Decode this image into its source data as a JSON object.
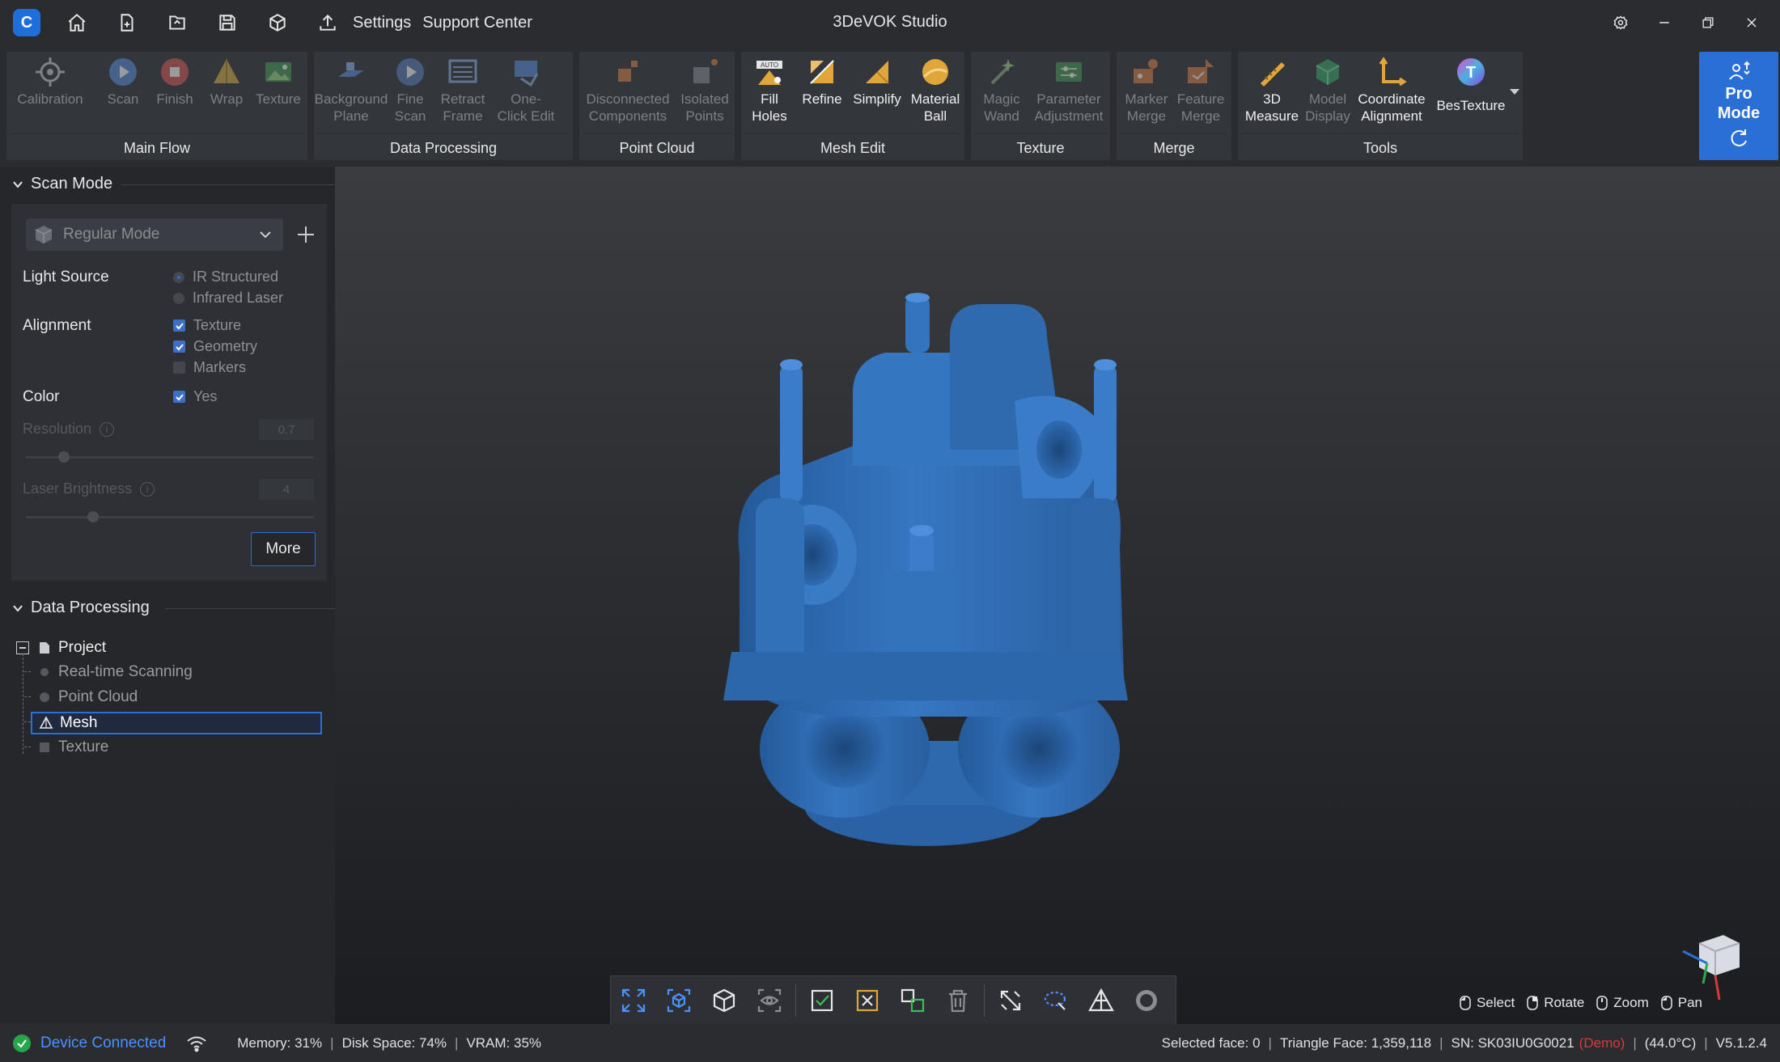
{
  "titlebar": {
    "logo": "C",
    "settings": "Settings",
    "support": "Support Center",
    "title": "3DeVOK Studio"
  },
  "ribbon": {
    "groups": [
      {
        "label": "Main Flow",
        "tools": [
          {
            "label": "Calibration",
            "icon": "crosshair-icon",
            "enabled": false
          },
          {
            "label": "Scan",
            "icon": "play-icon",
            "enabled": false
          },
          {
            "label": "Finish",
            "icon": "stop-icon",
            "enabled": false
          },
          {
            "label": "Wrap",
            "icon": "pyramid-icon",
            "enabled": false
          },
          {
            "label": "Texture",
            "icon": "image-icon",
            "enabled": false
          }
        ]
      },
      {
        "label": "Data Processing",
        "tools": [
          {
            "label": "Background\nPlane",
            "icon": "plane-icon",
            "enabled": false
          },
          {
            "label": "Fine\nScan",
            "icon": "fine-scan-icon",
            "enabled": false
          },
          {
            "label": "Retract\nFrame",
            "icon": "frame-icon",
            "enabled": false
          },
          {
            "label": "One-\nClick Edit",
            "icon": "edit-icon",
            "enabled": false
          }
        ]
      },
      {
        "label": "Point Cloud",
        "tools": [
          {
            "label": "Disconnected\nComponents",
            "icon": "components-icon",
            "enabled": false
          },
          {
            "label": "Isolated\nPoints",
            "icon": "points-icon",
            "enabled": false
          }
        ]
      },
      {
        "label": "Mesh Edit",
        "tools": [
          {
            "label": "Fill\nHoles",
            "icon": "fill-holes-icon",
            "enabled": true
          },
          {
            "label": "Refine",
            "icon": "refine-icon",
            "enabled": true
          },
          {
            "label": "Simplify",
            "icon": "simplify-icon",
            "enabled": true
          },
          {
            "label": "Material\nBall",
            "icon": "material-ball-icon",
            "enabled": true
          }
        ]
      },
      {
        "label": "Texture",
        "tools": [
          {
            "label": "Magic\nWand",
            "icon": "magic-wand-icon",
            "enabled": false
          },
          {
            "label": "Parameter\nAdjustment",
            "icon": "parameter-icon",
            "enabled": false
          }
        ]
      },
      {
        "label": "Merge",
        "tools": [
          {
            "label": "Marker\nMerge",
            "icon": "marker-merge-icon",
            "enabled": false
          },
          {
            "label": "Feature\nMerge",
            "icon": "feature-merge-icon",
            "enabled": false
          }
        ]
      },
      {
        "label": "Tools",
        "tools": [
          {
            "label": "3D\nMeasure",
            "icon": "measure-icon",
            "enabled": true
          },
          {
            "label": "Model\nDisplay",
            "icon": "model-display-icon",
            "enabled": false
          },
          {
            "label": "Coordinate\nAlignment",
            "icon": "coordinate-icon",
            "enabled": true
          },
          {
            "label": "BesTexture",
            "icon": "bestexture-icon",
            "enabled": true
          }
        ]
      }
    ],
    "pro_mode": "Pro\nMode"
  },
  "left_panel": {
    "scan_mode_header": "Scan Mode",
    "mode_select": "Regular Mode",
    "light_source_label": "Light Source",
    "light_options": [
      "IR Structured",
      "Infrared Laser"
    ],
    "alignment_label": "Alignment",
    "alignment_options": [
      "Texture",
      "Geometry",
      "Markers"
    ],
    "color_label": "Color",
    "color_option": "Yes",
    "resolution_label": "Resolution",
    "resolution_value": "0.7",
    "laser_label": "Laser Brightness",
    "laser_value": "4",
    "more_button": "More",
    "data_processing_header": "Data Processing",
    "tree": {
      "root": "Project",
      "items": [
        "Real-time Scanning",
        "Point Cloud",
        "Mesh",
        "Texture"
      ],
      "selected": "Mesh"
    }
  },
  "viewport": {
    "nav_hints": [
      "Select",
      "Rotate",
      "Zoom",
      "Pan"
    ]
  },
  "statusbar": {
    "device": "Device Connected",
    "memory": "Memory:  31%",
    "disk": "Disk Space:  74%",
    "vram": "VRAM:  35%",
    "selected_face": "Selected face: 0",
    "triangle_face": "Triangle Face: 1,359,118",
    "sn": "SN: SK03IU0G0021",
    "demo": "(Demo)",
    "temp": "(44.0°C)",
    "version": "V5.1.2.4"
  },
  "colors": {
    "accent": "#2a6fd6",
    "model": "#2f6fb6",
    "connected": "#4a93ff",
    "demo": "#d63a3a"
  }
}
